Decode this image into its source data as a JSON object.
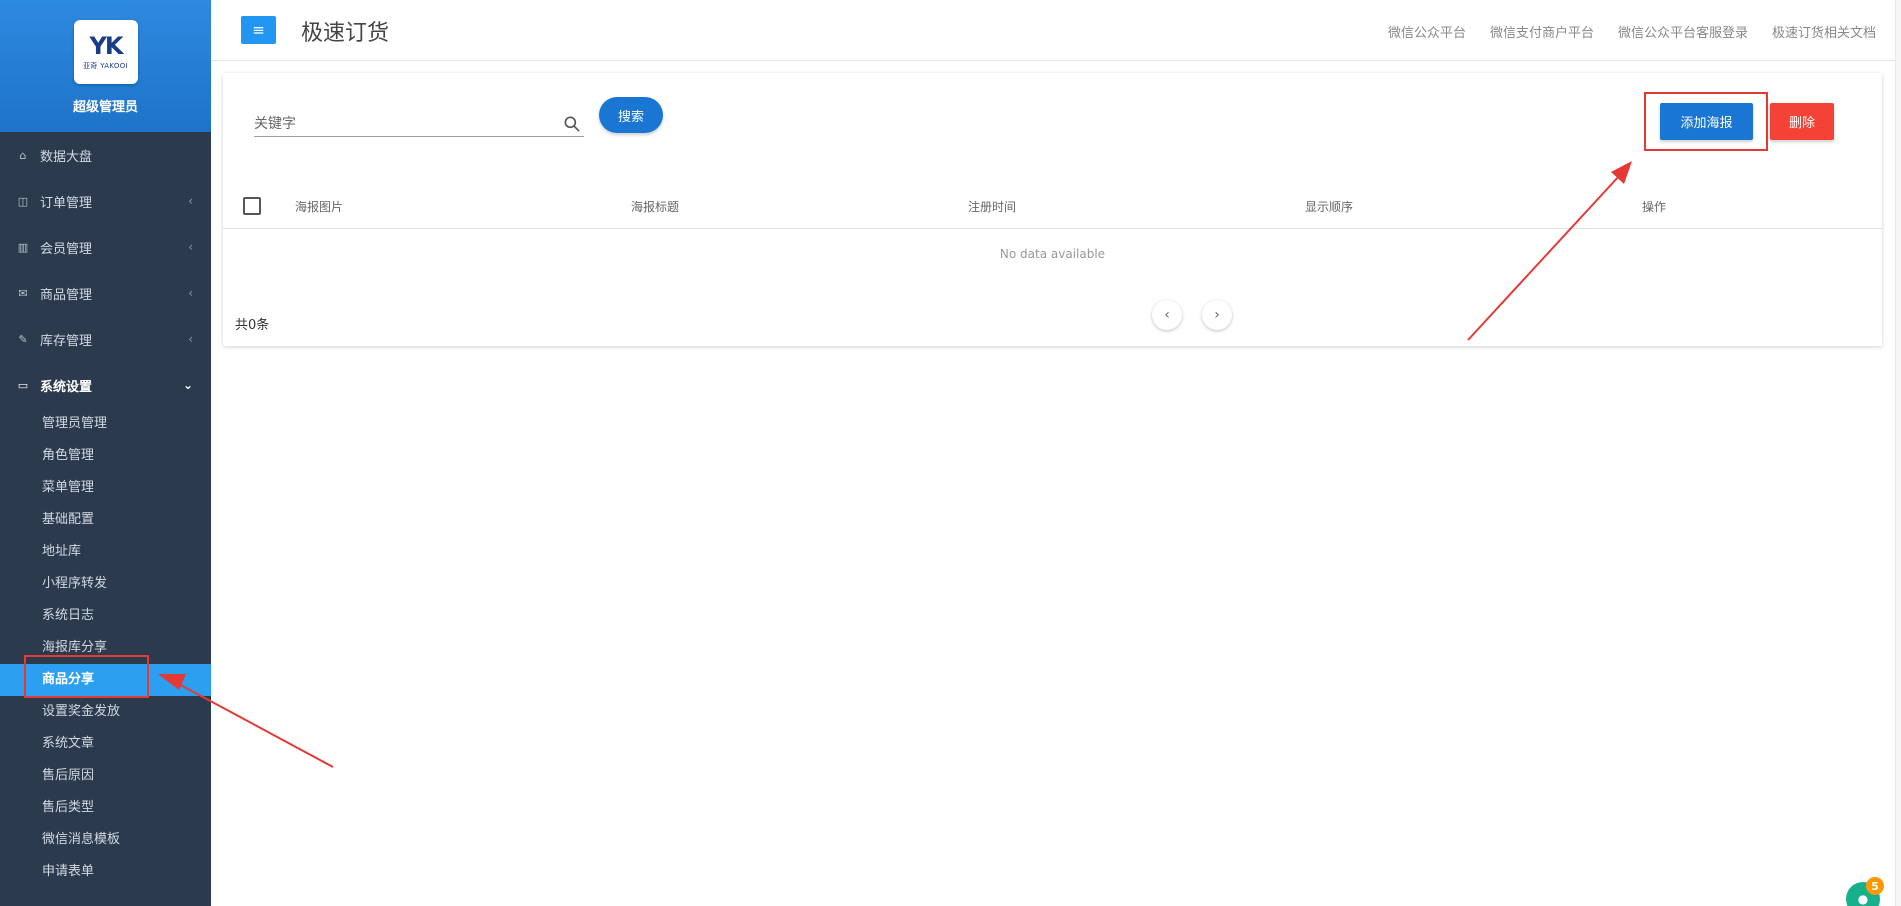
{
  "brand": {
    "logo_text": "YK",
    "logo_sub": "亚奇 YAKOOI",
    "role": "超级管理员"
  },
  "sidebar": {
    "items": [
      {
        "label": "数据大盘",
        "icon": "home-icon"
      },
      {
        "label": "订单管理",
        "icon": "columns-icon"
      },
      {
        "label": "会员管理",
        "icon": "bar-chart-icon"
      },
      {
        "label": "商品管理",
        "icon": "envelope-icon"
      },
      {
        "label": "库存管理",
        "icon": "edit-icon"
      },
      {
        "label": "系统设置",
        "icon": "monitor-icon"
      }
    ],
    "submenu": [
      "管理员管理",
      "角色管理",
      "菜单管理",
      "基础配置",
      "地址库",
      "小程序转发",
      "系统日志",
      "海报库分享",
      "商品分享",
      "设置奖金发放",
      "系统文章",
      "售后原因",
      "售后类型",
      "微信消息模板",
      "申请表单"
    ],
    "current_submenu": "商品分享"
  },
  "header": {
    "title": "极速订货",
    "links": [
      "微信公众平台",
      "微信支付商户平台",
      "微信公众平台客服登录",
      "极速订货相关文档"
    ]
  },
  "toolbar": {
    "search_placeholder": "关键字",
    "search_label": "搜索",
    "add_label": "添加海报",
    "delete_label": "删除"
  },
  "table": {
    "columns": [
      "海报图片",
      "海报标题",
      "注册时间",
      "显示顺序",
      "操作"
    ],
    "empty_text": "No data available",
    "total_text": "共0条"
  },
  "chat": {
    "badge": "5"
  },
  "colors": {
    "primary": "#1976d2",
    "danger": "#f44336",
    "sidebar_bg": "#2b3a4c",
    "active_sub": "#2c9ff0",
    "annotation": "#e53935"
  }
}
